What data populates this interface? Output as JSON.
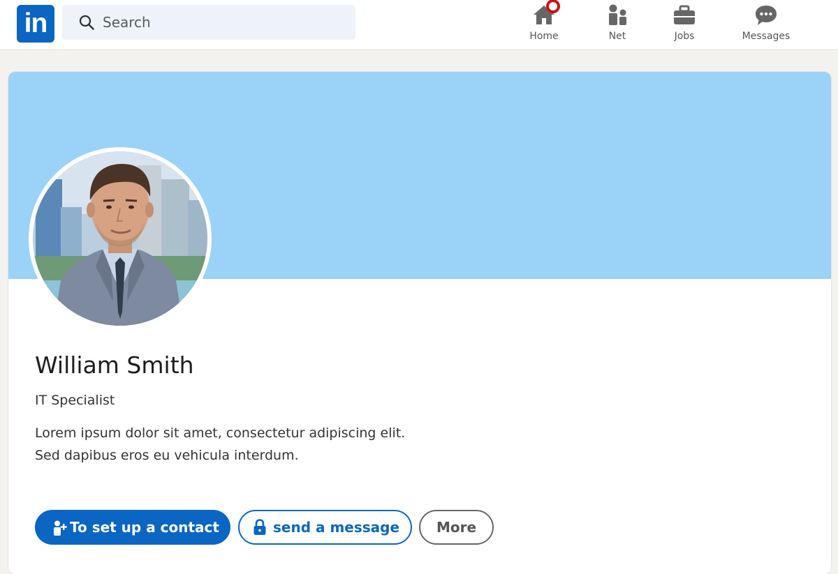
{
  "app": {
    "logo_text": "in",
    "brand_color": "#0a66c2"
  },
  "search": {
    "placeholder": "Search",
    "icon": "search-icon"
  },
  "nav": {
    "items": [
      {
        "label": "Home",
        "icon": "home-icon",
        "has_notification": true
      },
      {
        "label": "Net",
        "icon": "network-icon"
      },
      {
        "label": "Jobs",
        "icon": "briefcase-icon"
      },
      {
        "label": "Messages",
        "icon": "messages-icon"
      }
    ],
    "notification_color": "#cc1016"
  },
  "profile": {
    "banner_color": "#9bd2f8",
    "name": "William Smith",
    "headline": "IT Specialist",
    "about_lines": [
      "Lorem ipsum dolor sit amet, consectetur adipiscing elit.",
      "Sed dapibus eros eu vehicula interdum."
    ]
  },
  "actions": {
    "connect_label": "To set up a contact",
    "connect_icon": "add-person-icon",
    "message_label": "send a message",
    "message_icon": "lock-icon",
    "more_label": "More"
  }
}
